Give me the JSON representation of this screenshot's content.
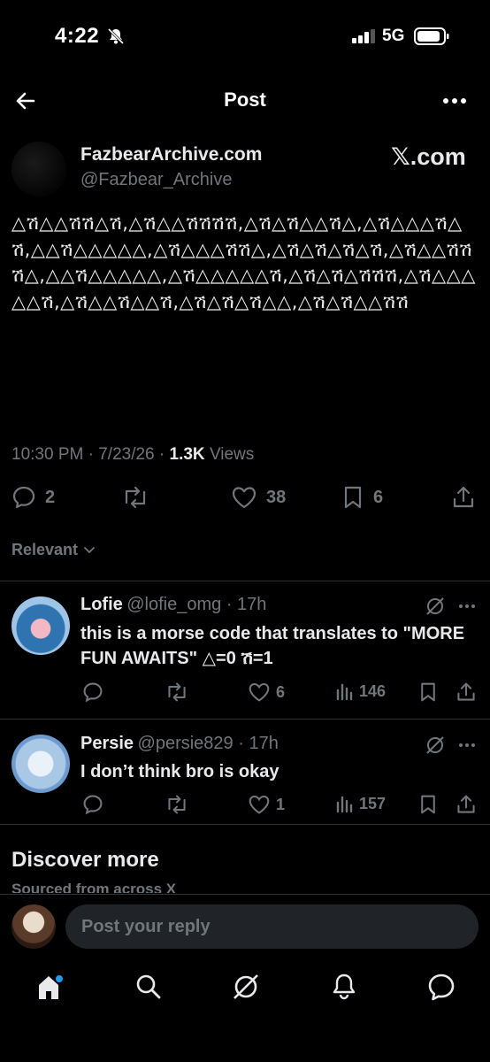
{
  "status_bar": {
    "time": "4:22",
    "network": "5G"
  },
  "header": {
    "title": "Post"
  },
  "author": {
    "name": "FazbearArchive.com",
    "handle": "@Fazbear_Archive",
    "badge": "𝕏.com"
  },
  "post": {
    "text": "△ሽ△△ሽሽ△ሽ,△ሽ△△ሽሽሽሽ,△ሽ△ሽ△△ሽ△,△ሽ△△△ሽ△ሽ,△△ሽ△△△△△,△ሽ△△△ሽሽ△,△ሽ△ሽ△ሽ△ሽ,△ሽ△△ሽሽሽ△,△△ሽ△△△△△,△ሽ△△△△△ሽ,△ሽ△ሽ△ሽሽሽ,△ሽ△△△△△ሽ,△ሽ△△ሽ△△ሽ,△ሽ△ሽ△ሽ△△,△ሽ△ሽ△△ሽሽ",
    "time": "10:30 PM",
    "date": "7/23/26",
    "views_count": "1.3K",
    "views_label": "Views",
    "replies": "2",
    "likes": "38",
    "bookmarks": "6"
  },
  "filter": {
    "label": "Relevant"
  },
  "replies": [
    {
      "name": "Lofie",
      "handle": "@lofie_omg",
      "age": "17h",
      "text": "this is a morse code that translates to \"MORE FUN AWAITS\" △=0 ሽ=1",
      "likes": "6",
      "views": "146"
    },
    {
      "name": "Persie",
      "handle": "@persie829",
      "age": "17h",
      "text": "I don’t think bro is okay",
      "likes": "1",
      "views": "157"
    }
  ],
  "discover": {
    "title": "Discover more",
    "subtitle": "Sourced from across X"
  },
  "reply_box": {
    "placeholder": "Post your reply"
  },
  "colors": {
    "background": "#000000",
    "muted": "#71767b",
    "text": "#e7e9ea",
    "accent": "#1d9bf0"
  }
}
